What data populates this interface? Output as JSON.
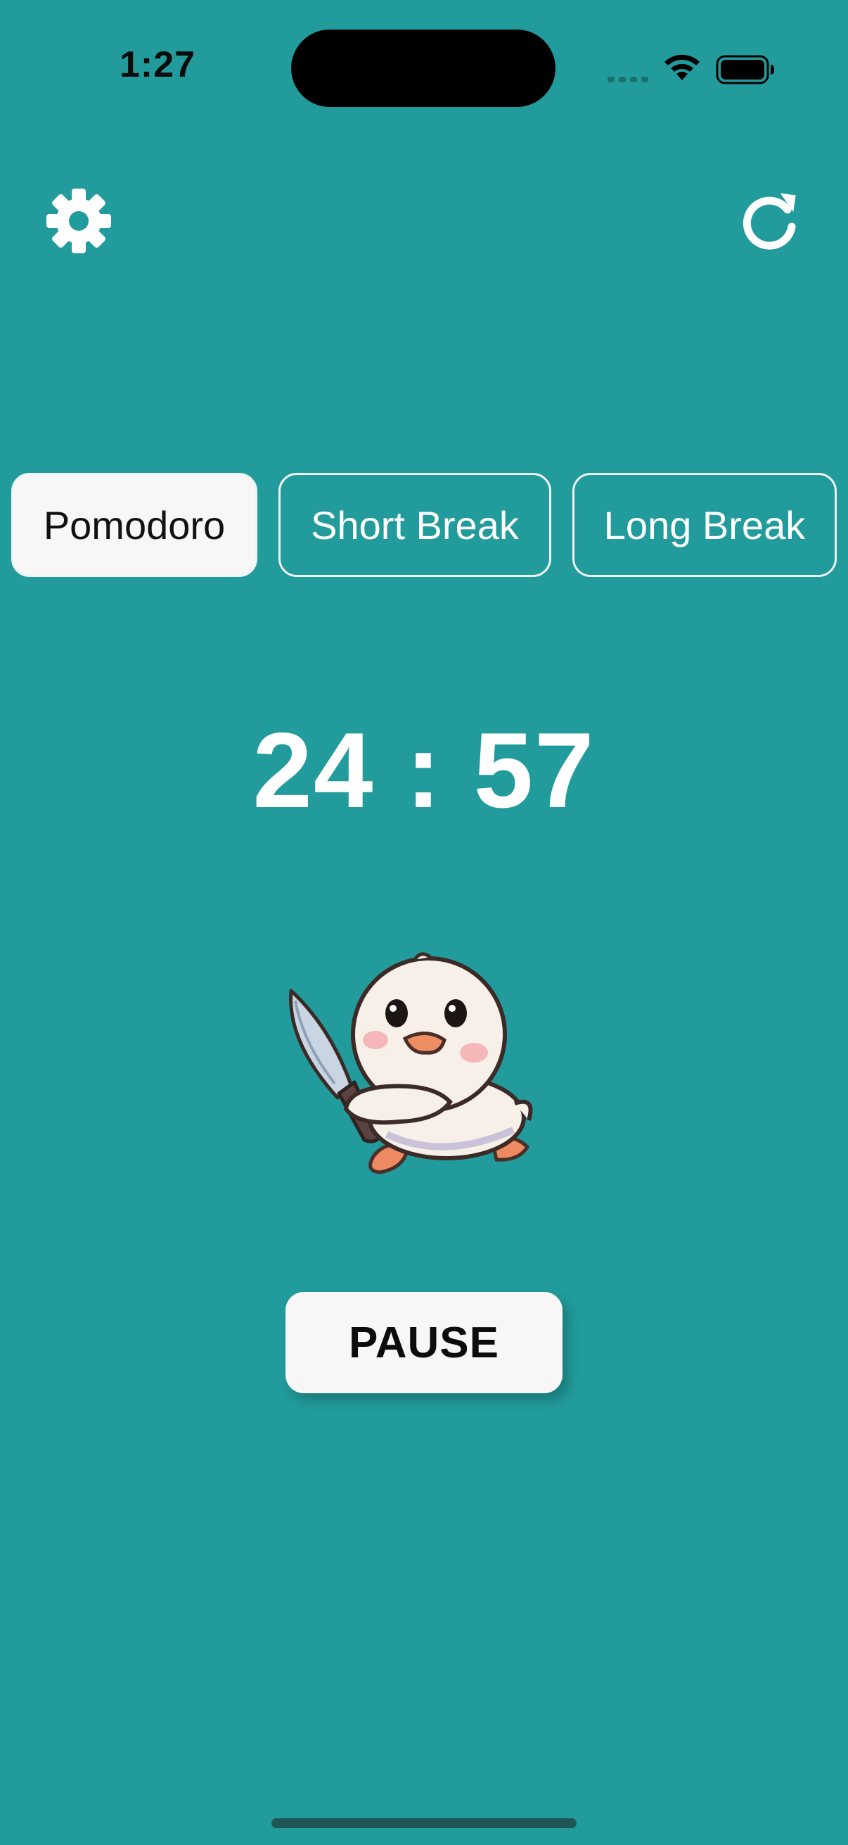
{
  "status_bar": {
    "time": "1:27"
  },
  "header": {
    "settings_icon": "gear-icon",
    "reset_icon": "refresh-icon"
  },
  "tabs": [
    {
      "label": "Pomodoro",
      "active": true
    },
    {
      "label": "Short Break",
      "active": false
    },
    {
      "label": "Long Break",
      "active": false
    }
  ],
  "timer": {
    "display": "24 : 57"
  },
  "mascot": {
    "icon": "duck-with-knife-illustration"
  },
  "controls": {
    "pause_label": "PAUSE"
  },
  "colors": {
    "background": "#229b9c",
    "tab_active_bg": "#f7f7f7",
    "text_light": "#ffffff",
    "text_dark": "#111111"
  }
}
